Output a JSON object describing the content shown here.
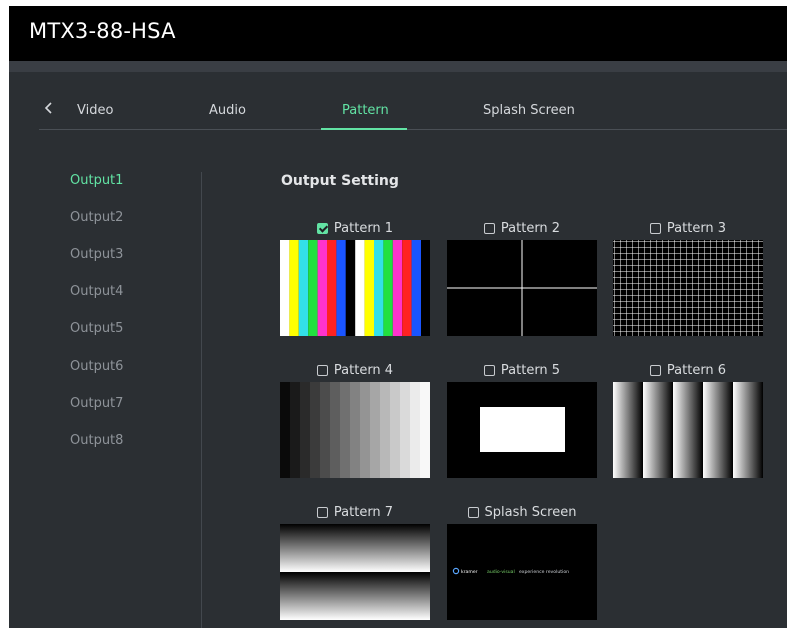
{
  "app": {
    "title": "MTX3-88-HSA"
  },
  "tabs": [
    {
      "label": "Video"
    },
    {
      "label": "Audio"
    },
    {
      "label": "Pattern"
    },
    {
      "label": "Splash Screen"
    }
  ],
  "active_tab": "Pattern",
  "outputs": [
    "Output1",
    "Output2",
    "Output3",
    "Output4",
    "Output5",
    "Output6",
    "Output7",
    "Output8"
  ],
  "active_output": "Output1",
  "section_title": "Output Setting",
  "patterns": [
    {
      "label": "Pattern 1",
      "checked": true
    },
    {
      "label": "Pattern 2",
      "checked": false
    },
    {
      "label": "Pattern 3",
      "checked": false
    },
    {
      "label": "Pattern 4",
      "checked": false
    },
    {
      "label": "Pattern 5",
      "checked": false
    },
    {
      "label": "Pattern 6",
      "checked": false
    },
    {
      "label": "Pattern 7",
      "checked": false
    },
    {
      "label": "Splash Screen",
      "checked": false
    }
  ],
  "splash": {
    "brand": "kramer",
    "tagline_accent": "audio-visual",
    "tagline_rest": " experience revolution"
  },
  "colors": {
    "accent": "#62e3a4",
    "background": "#2b2f33",
    "titlebar": "#000000"
  }
}
